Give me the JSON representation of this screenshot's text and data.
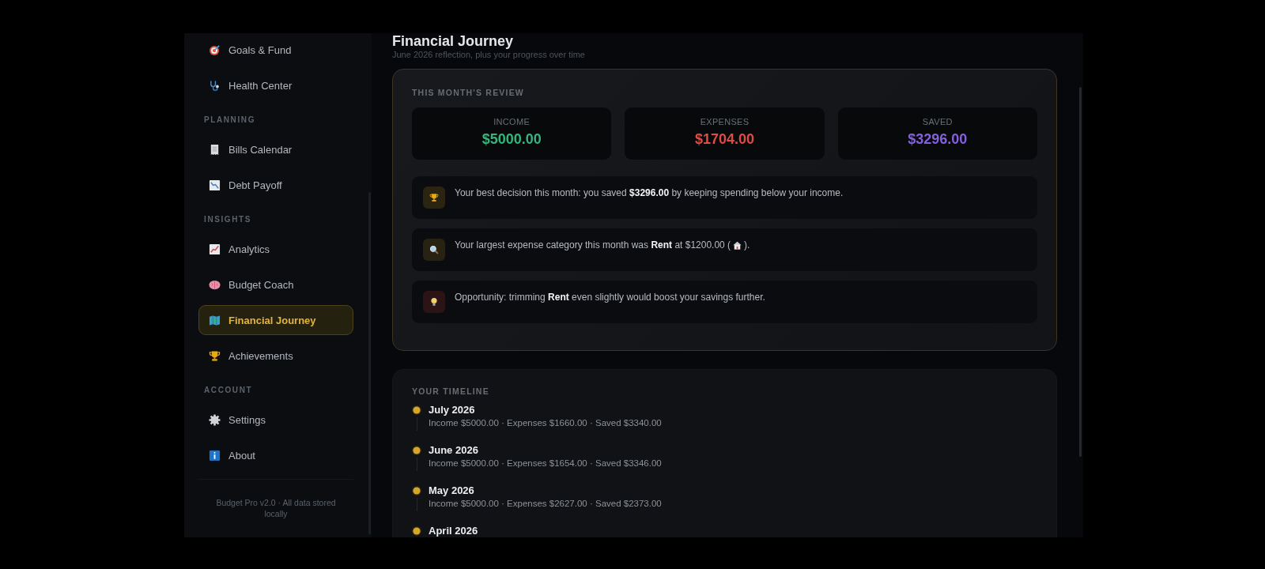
{
  "sidebar": {
    "sections": [
      {
        "items": [
          {
            "label": "Goals & Fund",
            "selected": false
          },
          {
            "label": "Health Center",
            "selected": false
          }
        ]
      },
      {
        "heading": "PLANNING",
        "items": [
          {
            "label": "Bills Calendar",
            "selected": false
          },
          {
            "label": "Debt Payoff",
            "selected": false
          }
        ]
      },
      {
        "heading": "INSIGHTS",
        "items": [
          {
            "label": "Analytics",
            "selected": false
          },
          {
            "label": "Budget Coach",
            "selected": false
          },
          {
            "label": "Financial Journey",
            "selected": true
          },
          {
            "label": "Achievements",
            "selected": false
          }
        ]
      },
      {
        "heading": "ACCOUNT",
        "items": [
          {
            "label": "Settings",
            "selected": false
          },
          {
            "label": "About",
            "selected": false
          }
        ]
      }
    ],
    "footer": "Budget Pro v2.0 · All data stored locally"
  },
  "header": {
    "title": "Financial Journey",
    "subtitle": "June 2026 reflection, plus your progress over time"
  },
  "review": {
    "heading": "THIS MONTH'S REVIEW",
    "stats": [
      {
        "label": "INCOME",
        "value": "$5000.00",
        "color": "#34b57c"
      },
      {
        "label": "EXPENSES",
        "value": "$1704.00",
        "color": "#e04b45"
      },
      {
        "label": "SAVED",
        "value": "$3296.00",
        "color": "#8560dc"
      }
    ],
    "insights": [
      {
        "kind": "win",
        "text": "Your best decision this month: you saved **$3296.00** by keeping spending below your income."
      },
      {
        "kind": "largest",
        "text": "Your largest expense category this month was **Rent** at $1200.00 (",
        "suffix": ")."
      },
      {
        "kind": "tip",
        "text": "Opportunity: trimming **Rent** even slightly would boost your savings further."
      }
    ]
  },
  "timeline": {
    "heading": "YOUR TIMELINE",
    "entries": [
      {
        "month": "July 2026",
        "summary": "Income $5000.00 · Expenses $1660.00 · Saved $3340.00"
      },
      {
        "month": "June 2026",
        "summary": "Income $5000.00 · Expenses $1654.00 · Saved $3346.00"
      },
      {
        "month": "May 2026",
        "summary": "Income $5000.00 · Expenses $2627.00 · Saved $2373.00"
      },
      {
        "month": "April 2026"
      }
    ]
  }
}
